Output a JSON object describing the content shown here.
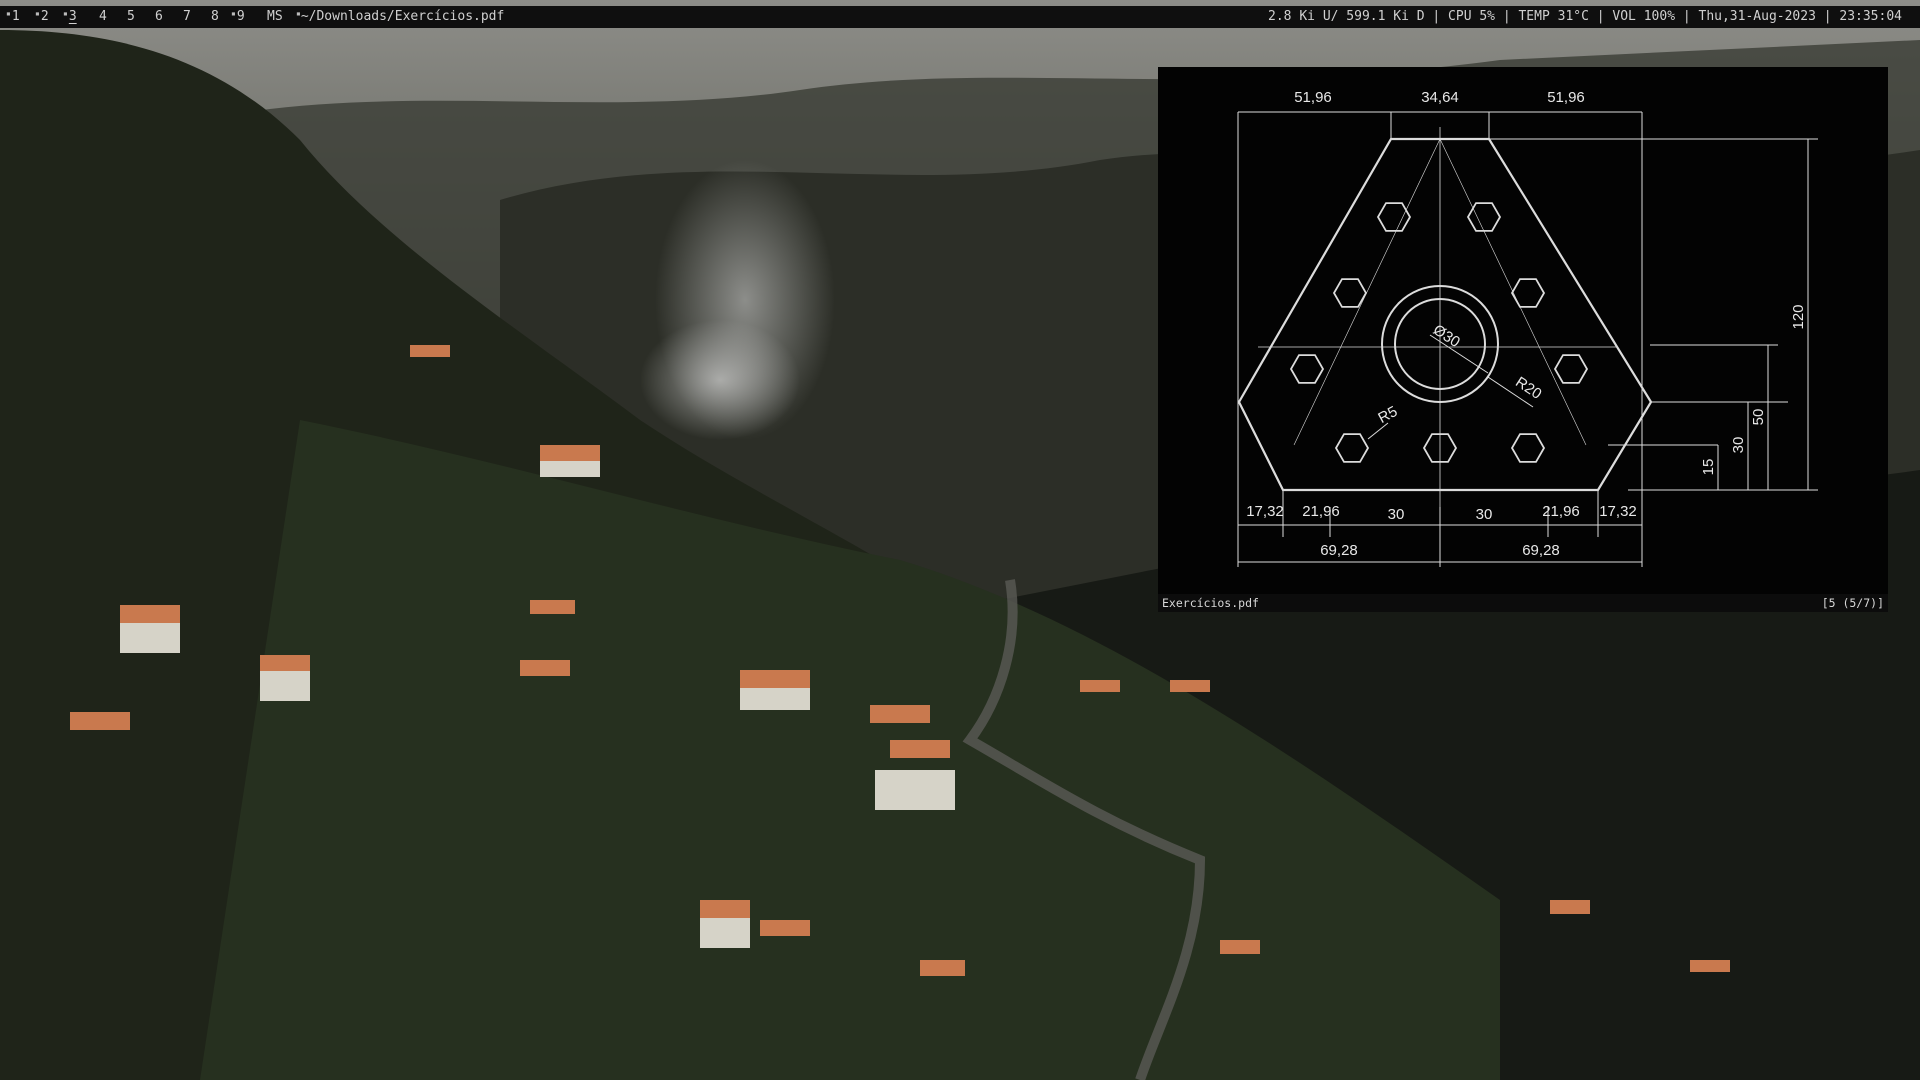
{
  "workspaces": [
    {
      "label": "1",
      "occupied": true,
      "active": false
    },
    {
      "label": "2",
      "occupied": true,
      "active": false
    },
    {
      "label": "3",
      "occupied": true,
      "active": true
    },
    {
      "label": "4",
      "occupied": false,
      "active": false
    },
    {
      "label": "5",
      "occupied": false,
      "active": false
    },
    {
      "label": "6",
      "occupied": false,
      "active": false
    },
    {
      "label": "7",
      "occupied": false,
      "active": false
    },
    {
      "label": "8",
      "occupied": true,
      "active": false
    },
    {
      "label": "9",
      "occupied": false,
      "active": false
    }
  ],
  "bar": {
    "layout": "MS",
    "window_title": "~/Downloads/Exercícios.pdf",
    "status_text": "2.8 Ki U/ 599.1 Ki D | CPU 5% | TEMP 31°C | VOL 100% | Thu,31-Aug-2023 | 23:35:04"
  },
  "viewer": {
    "filename": "Exercícios.pdf",
    "page_info": "[5 (5/7)]"
  },
  "drawing": {
    "top_dims": [
      "51,96",
      "34,64",
      "51,96"
    ],
    "right_dims": [
      "120",
      "50",
      "30",
      "15"
    ],
    "bottom_dims_row1": [
      "17,32",
      "21,96",
      "30",
      "30",
      "21,96",
      "17,32"
    ],
    "bottom_dims_row2": [
      "69,28",
      "69,28"
    ],
    "diameter": "Ø30",
    "radius_large": "R20",
    "radius_small": "R5"
  },
  "colors": {
    "bar_bg": "#0f0f0f",
    "bar_text": "#d0d0d0",
    "viewer_bg": "#030303",
    "drawing_lines": "#dcdcdc"
  }
}
